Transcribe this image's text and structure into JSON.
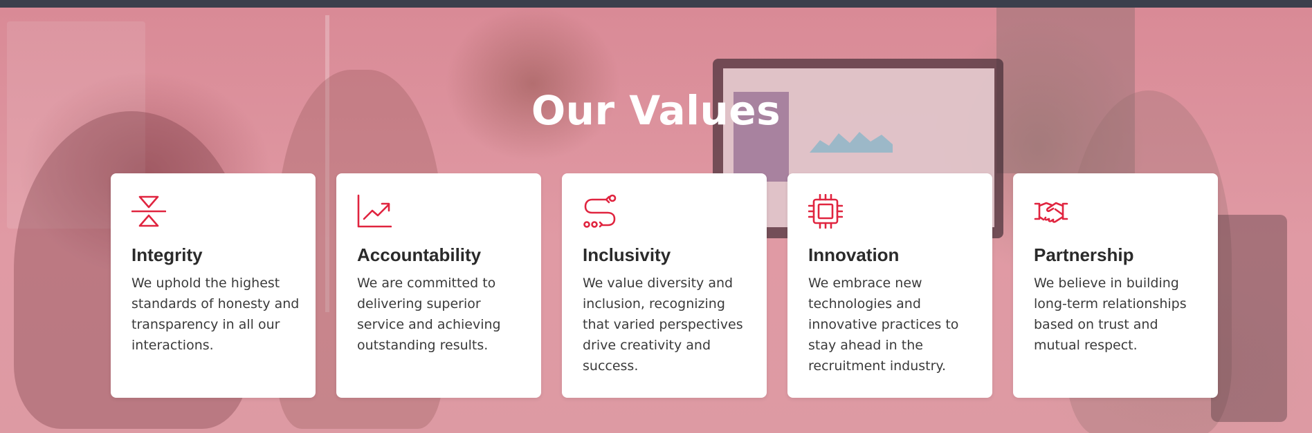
{
  "section": {
    "title": "Our Values"
  },
  "colors": {
    "accent": "#e0243f",
    "overlay": "#e08a96",
    "card_bg": "#ffffff",
    "title_text": "#ffffff"
  },
  "values": [
    {
      "icon": "integrity-icon",
      "title": "Integrity",
      "text": "We uphold the highest standards of honesty and transparency in all our interactions."
    },
    {
      "icon": "growth-chart-icon",
      "title": "Accountability",
      "text": "We are committed to delivering superior service and achieving outstanding results."
    },
    {
      "icon": "route-icon",
      "title": "Inclusivity",
      "text": "We value diversity and inclusion, recognizing that varied perspectives drive creativity and success."
    },
    {
      "icon": "chip-icon",
      "title": "Innovation",
      "text": "We embrace new technologies and innovative practices to stay ahead in the recruitment industry."
    },
    {
      "icon": "handshake-icon",
      "title": "Partnership",
      "text": "We believe in building long-term relationships based on trust and mutual respect."
    }
  ]
}
